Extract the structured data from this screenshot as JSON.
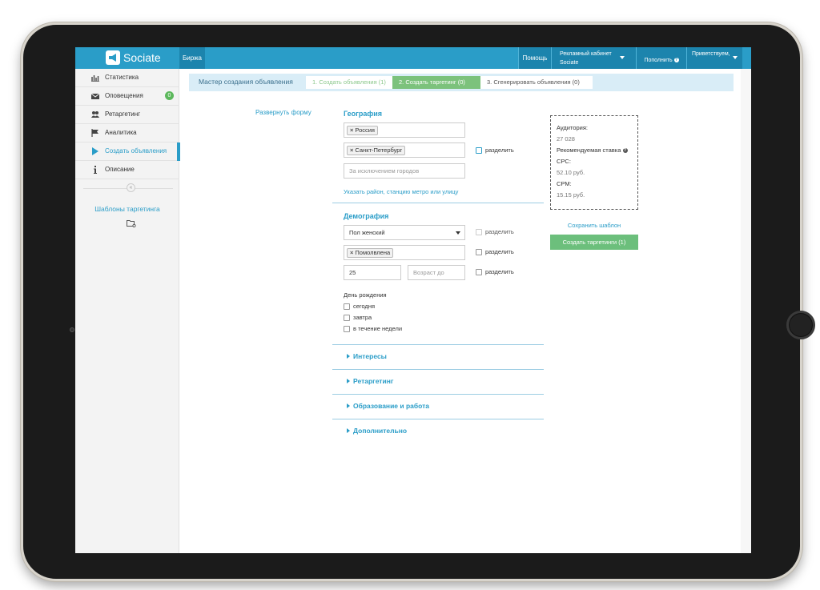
{
  "header": {
    "brand": "Sociate",
    "tab_birzha": "Биржа",
    "help": "Помощь",
    "cabinet_label": "Рекламный кабинет",
    "cabinet_value": "Sociate",
    "pay": "Пополнить",
    "hello": "Приветствуем,"
  },
  "sidebar": {
    "items": [
      {
        "label": "Статистика",
        "icon": "bar-chart-icon"
      },
      {
        "label": "Оповещения",
        "icon": "envelope-icon",
        "badge": "0"
      },
      {
        "label": "Ретаргетинг",
        "icon": "users-icon"
      },
      {
        "label": "Аналитика",
        "icon": "flag-icon"
      },
      {
        "label": "Создать объявления",
        "icon": "play-icon"
      },
      {
        "label": "Описание",
        "icon": "info-icon"
      }
    ],
    "collapse": "«",
    "templates": "Шаблоны таргетинга"
  },
  "wizard": {
    "title": "Мастер создания объявления",
    "step1": "1. Создать объявления (1)",
    "step2": "2. Создать таргетинг (0)",
    "step3": "3. Сгенерировать объявления (0)"
  },
  "expand_form": "Развернуть форму",
  "geo": {
    "title": "География",
    "country_tag": "Россия",
    "city_tag": "Санкт-Петербург",
    "split_label": "разделить",
    "exclude_placeholder": "За исключением городов",
    "district_link": "Указать район, станцию метро или улицу"
  },
  "demo": {
    "title": "Демография",
    "gender_value": "Пол женский",
    "split1": "разделить",
    "status_tag": "Помолвлена",
    "split2": "разделить",
    "age_from": "25",
    "age_to_placeholder": "Возраст до",
    "split3": "разделить",
    "birthday_title": "День рождения",
    "bd_today": "сегодня",
    "bd_tomorrow": "завтра",
    "bd_week": "в течение недели"
  },
  "sections": [
    "Интересы",
    "Ретаргетинг",
    "Образование и работа",
    "Дополнительно"
  ],
  "audience": {
    "label": "Аудитория:",
    "value": "27 028",
    "rate_label": "Рекомендуемая ставка",
    "cpc_label": "CPC:",
    "cpc_value": "52.10 руб.",
    "cpm_label": "CPM:",
    "cpm_value": "15.15 руб."
  },
  "save_template": "Сохранить шаблон",
  "create_button": "Создать таргетинги (1)",
  "colors": {
    "accent": "#2a9dc8",
    "header_dark": "#1c84ad",
    "success": "#6cbf7c",
    "wizard_bg": "#d9edf7"
  }
}
